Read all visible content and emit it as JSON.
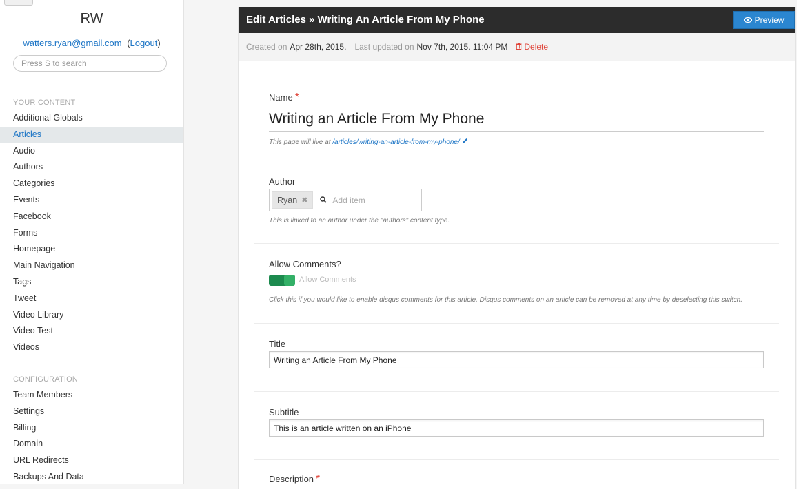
{
  "sidebar": {
    "brand": "RW",
    "account": {
      "email": "watters.ryan@gmail.com",
      "open_paren": "(",
      "logout": "Logout",
      "close_paren": ")"
    },
    "search": {
      "placeholder": "Press S to search"
    },
    "content_heading": "YOUR CONTENT",
    "content_items": [
      {
        "label": "Additional Globals"
      },
      {
        "label": "Articles",
        "active": true
      },
      {
        "label": "Audio"
      },
      {
        "label": "Authors"
      },
      {
        "label": "Categories"
      },
      {
        "label": "Events"
      },
      {
        "label": "Facebook"
      },
      {
        "label": "Forms"
      },
      {
        "label": "Homepage"
      },
      {
        "label": "Main Navigation"
      },
      {
        "label": "Tags"
      },
      {
        "label": "Tweet"
      },
      {
        "label": "Video Library"
      },
      {
        "label": "Video Test"
      },
      {
        "label": "Videos"
      }
    ],
    "config_heading": "CONFIGURATION",
    "config_items": [
      {
        "label": "Team Members"
      },
      {
        "label": "Settings"
      },
      {
        "label": "Billing"
      },
      {
        "label": "Domain"
      },
      {
        "label": "URL Redirects"
      },
      {
        "label": "Backups And Data"
      }
    ]
  },
  "header": {
    "title": "Edit Articles » Writing An Article From My Phone",
    "preview_label": "Preview"
  },
  "meta": {
    "created_label": "Created on",
    "created_value": "Apr 28th, 2015.",
    "updated_label": "Last updated on",
    "updated_value": "Nov 7th, 2015. 11:04 PM",
    "delete_label": "Delete"
  },
  "form": {
    "name": {
      "label": "Name",
      "required_mark": "*",
      "value": "Writing an Article From My Phone",
      "help_prefix": "This page will live at",
      "url": "/articles/writing-an-article-from-my-phone/"
    },
    "author": {
      "label": "Author",
      "tag": "Ryan",
      "add_placeholder": "Add item",
      "help": "This is linked to an author under the \"authors\" content type."
    },
    "comments": {
      "label": "Allow Comments?",
      "toggle_label": "Allow Comments",
      "enabled": true,
      "help": "Click this if you would like to enable disqus comments for this article. Disqus comments on an article can be removed at any time by deselecting this switch."
    },
    "title": {
      "label": "Title",
      "value": "Writing an Article From My Phone"
    },
    "subtitle": {
      "label": "Subtitle",
      "value": "This is an article written on an iPhone"
    },
    "description": {
      "label": "Description",
      "required_mark": "*"
    }
  },
  "colors": {
    "accent": "#1b74c5",
    "header_bg": "#2c2c2c",
    "preview_bg": "#2b86d0",
    "toggle_on": "#33b067",
    "danger": "#e0453a"
  }
}
